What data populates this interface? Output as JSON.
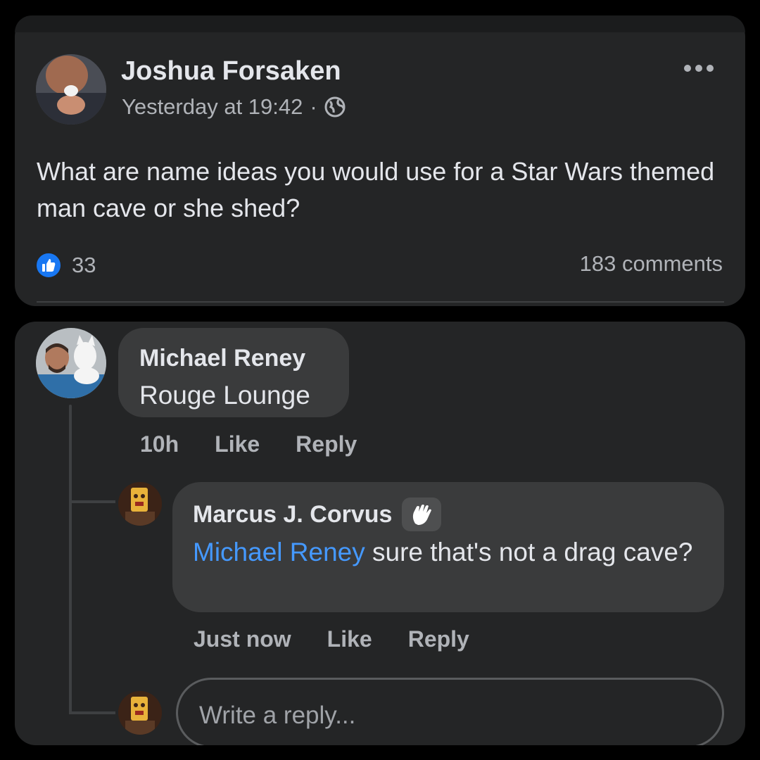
{
  "post": {
    "author": "Joshua Forsaken",
    "timestamp": "Yesterday at 19:42",
    "separator": "·",
    "privacy_icon": "globe-icon",
    "more_icon": "more-horizontal-icon",
    "text": "What are name ideas you would use for a Star Wars themed man cave or she shed?",
    "reactions": {
      "icon": "like-icon",
      "count": "33"
    },
    "comments_count": "183 comments"
  },
  "comments": [
    {
      "author": "Michael Reney",
      "text": "Rouge Lounge",
      "time": "10h",
      "like_label": "Like",
      "reply_label": "Reply"
    }
  ],
  "reply": {
    "author": "Marcus J. Corvus",
    "badge_icon": "wave-icon",
    "mention": "Michael Reney",
    "text": " sure that's not a drag cave?",
    "time": "Just now",
    "like_label": "Like",
    "reply_label": "Reply"
  },
  "composer": {
    "placeholder": "Write a reply..."
  },
  "colors": {
    "background": "#000000",
    "card": "#242526",
    "bubble": "#3a3b3c",
    "text_primary": "#e4e6eb",
    "text_secondary": "#b0b3b8",
    "mention": "#4599ff",
    "like_blue": "#1877f2"
  }
}
